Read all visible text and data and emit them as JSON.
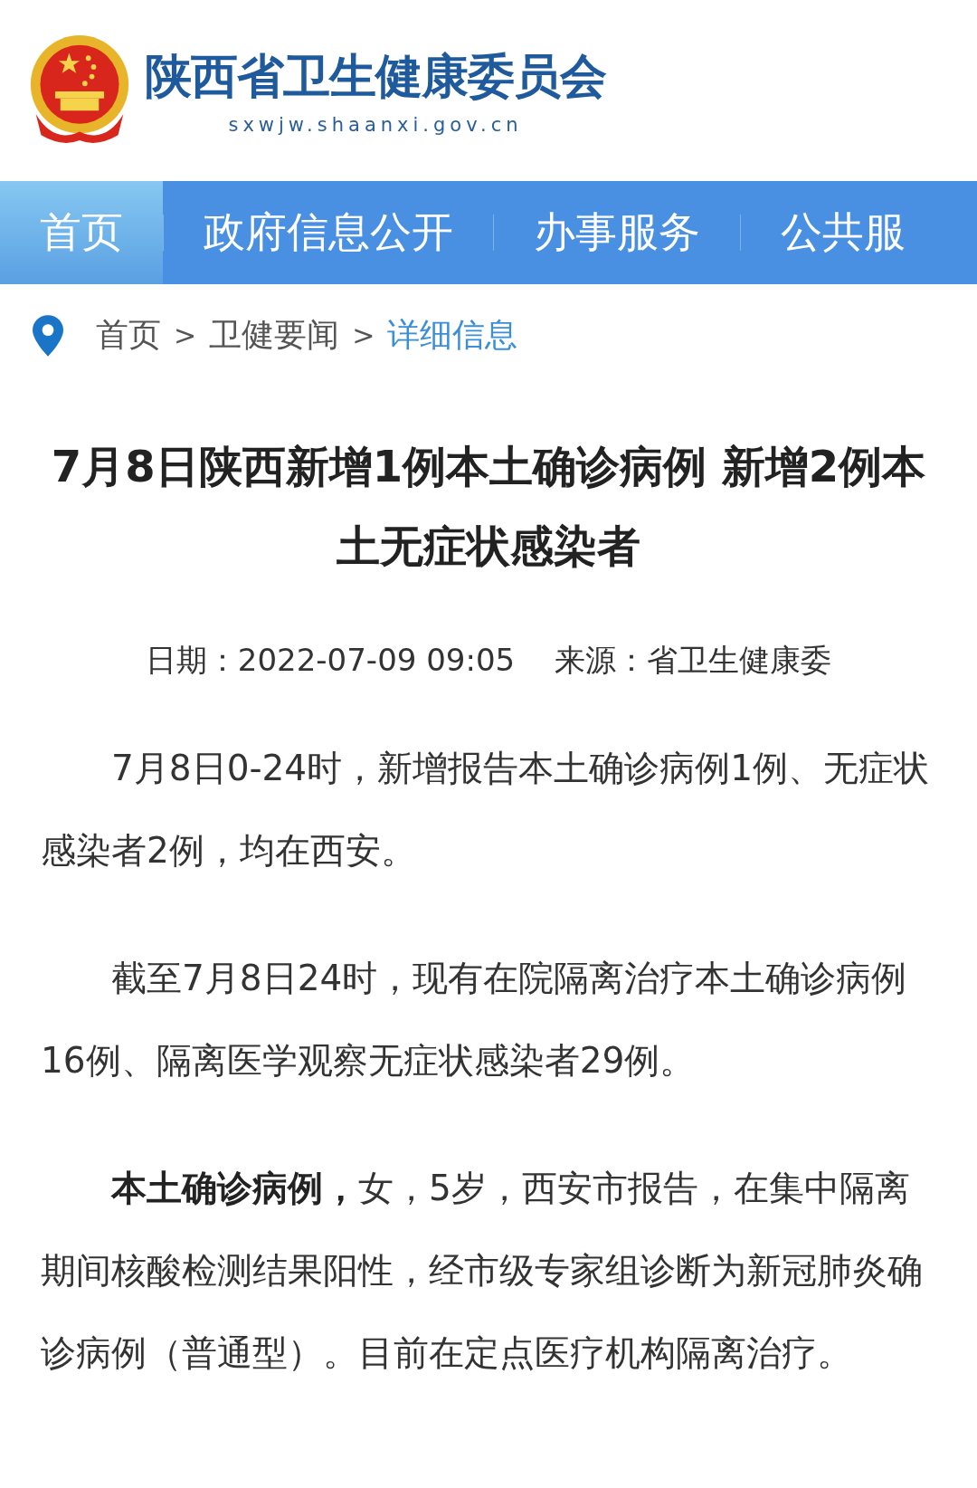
{
  "site": {
    "name": "陕西省卫生健康委员会",
    "domain": "sxwjw.shaanxi.gov.cn"
  },
  "nav": [
    {
      "label": "首页",
      "selected": true
    },
    {
      "label": "政府信息公开",
      "selected": false
    },
    {
      "label": "办事服务",
      "selected": false
    },
    {
      "label": "公共服",
      "selected": false
    }
  ],
  "breadcrumb": [
    {
      "label": "首页",
      "selected": false,
      "separator": ">"
    },
    {
      "label": "卫健要闻",
      "selected": false,
      "separator": ">"
    },
    {
      "label": "详细信息",
      "selected": true
    }
  ],
  "article": {
    "title": "7月8日陕西新增1例本土确诊病例 新增2例本土无症状感染者",
    "date": "日期：2022-07-09 09:05",
    "source": "来源：省卫生健康委",
    "paragraphs": [
      "7月8日0-24时，新增报告本土确诊病例1例、无症状感染者2例，均在西安。",
      "截至7月8日24时，现有在院隔离治疗本土确诊病例16例、隔离医学观察无症状感染者29例。",
      "**本土确诊病例，**女，5岁，西安市报告，在集中隔离期间核酸检测结果阳性，经市级专家组诊断为新冠肺炎确诊病例（普通型）。目前在定点医疗机构隔离治疗。"
    ]
  }
}
